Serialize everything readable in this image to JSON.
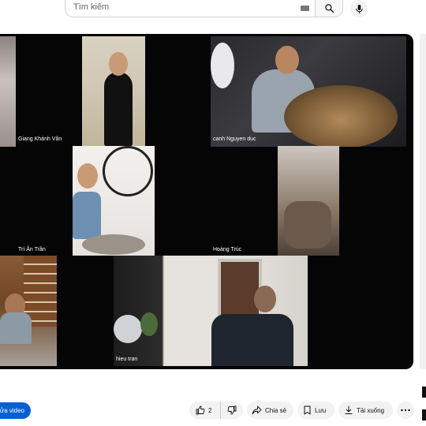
{
  "search": {
    "placeholder": "Tìm kiếm"
  },
  "meeting": {
    "participants": [
      {
        "name": ""
      },
      {
        "name": "Giang Khánh Vân"
      },
      {
        "name": "canh Nguyen duc"
      },
      {
        "name": "Trí Ân Trần"
      },
      {
        "name": "Hoàng Trúc"
      },
      {
        "name": ""
      },
      {
        "name": "hieu tran"
      }
    ]
  },
  "actions": {
    "subscribe_label": "ửa video",
    "like_count": "2",
    "share_label": "Chia sẻ",
    "save_label": "Lưu",
    "download_label": "Tải xuống"
  },
  "colors": {
    "subscribe_bg": "#065fd4",
    "player_bg": "#050505",
    "pill_bg": "#f2f2f2"
  }
}
